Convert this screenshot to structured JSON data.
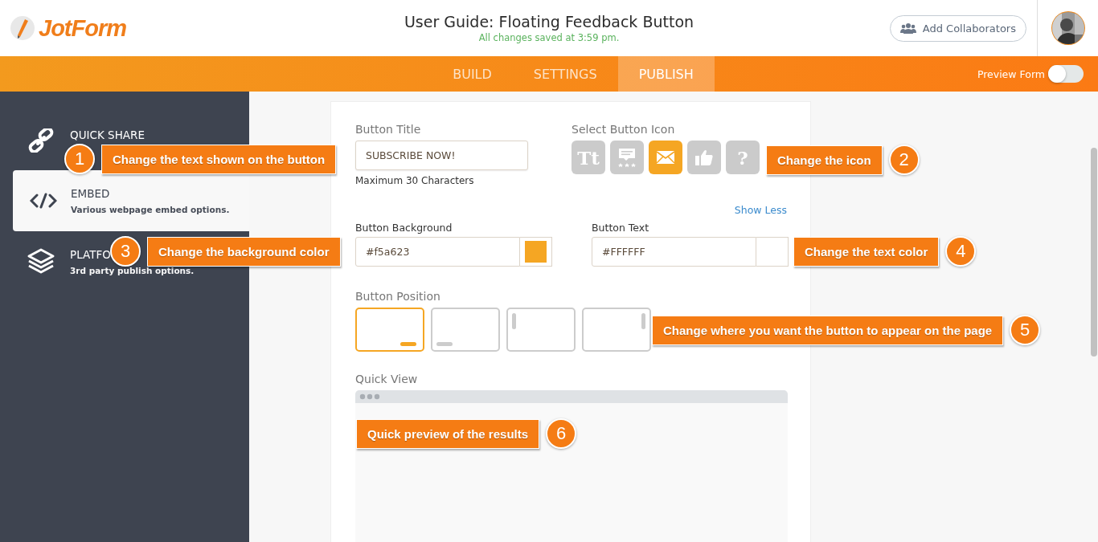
{
  "header": {
    "logo": "JotForm",
    "title": "User Guide: Floating Feedback Button",
    "save_status": "All changes saved at 3:59 pm.",
    "collaborators_button": "Add Collaborators"
  },
  "tabs": [
    {
      "label": "BUILD",
      "selected": false
    },
    {
      "label": "SETTINGS",
      "selected": false
    },
    {
      "label": "PUBLISH",
      "selected": true
    }
  ],
  "preview_toggle": {
    "label": "Preview Form",
    "on": false
  },
  "sidebar": {
    "items": [
      {
        "kind": "link",
        "title": "QUICK SHARE",
        "selected": false
      },
      {
        "kind": "code",
        "title": "EMBED",
        "subtitle": "Various webpage embed options.",
        "selected": true
      },
      {
        "kind": "layers",
        "title": "PLATFO",
        "subtitle": "3rd party publish options.",
        "selected": false
      }
    ]
  },
  "form": {
    "button_title": {
      "label": "Button Title",
      "value": "SUBSCRIBE NOW!",
      "hint": "Maximum 30 Characters"
    },
    "icon_picker": {
      "label": "Select Button Icon",
      "icons": [
        {
          "kind": "glyph",
          "glyph": "Tt",
          "selected": false
        },
        {
          "kind": "comment",
          "selected": false
        },
        {
          "kind": "mail",
          "selected": true
        },
        {
          "kind": "like",
          "selected": false
        },
        {
          "kind": "glyph",
          "glyph": "?",
          "selected": false
        }
      ]
    },
    "show_less": "Show Less",
    "background": {
      "label": "Button Background",
      "value": "#f5a623",
      "color": "#f5a623"
    },
    "text_color": {
      "label": "Button Text",
      "value": "#FFFFFF",
      "color": "#ffffff"
    },
    "position": {
      "label": "Button Position",
      "options": [
        {
          "kind": "bottom-right",
          "selected": true
        },
        {
          "kind": "bottom-left",
          "selected": false
        },
        {
          "kind": "left",
          "selected": false
        },
        {
          "kind": "right",
          "selected": false
        }
      ]
    },
    "quick_view": {
      "label": "Quick View"
    }
  },
  "callouts": [
    {
      "number": "1",
      "text": "Change the text shown on the button"
    },
    {
      "number": "2",
      "text": "Change the icon"
    },
    {
      "number": "3",
      "text": "Change the background color"
    },
    {
      "number": "4",
      "text": "Change the text color"
    },
    {
      "number": "5",
      "text": "Change where you want the button to appear on the page"
    },
    {
      "number": "6",
      "text": "Quick preview of the results"
    }
  ]
}
